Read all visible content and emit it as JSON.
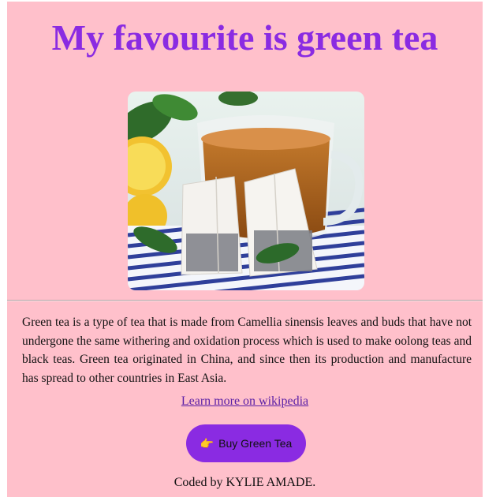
{
  "header": {
    "title": "My favourite is green tea"
  },
  "image": {
    "alt": "Green tea"
  },
  "content": {
    "description": "Green tea is a type of tea that is made from Camellia sinensis leaves and buds that have not undergone the same withering and oxidation process which is used to make oolong teas and black teas. Green tea originated in China, and since then its production and manufacture has spread to other countries in East Asia.",
    "link_text": "Learn more on wikipedia"
  },
  "button": {
    "icon": "👉",
    "label": "Buy Green Tea"
  },
  "footer": {
    "text": "Coded by KYLIE AMADE."
  },
  "colors": {
    "background": "#ffc0cb",
    "accent": "#8a2be2",
    "link": "#5b1fa6"
  }
}
